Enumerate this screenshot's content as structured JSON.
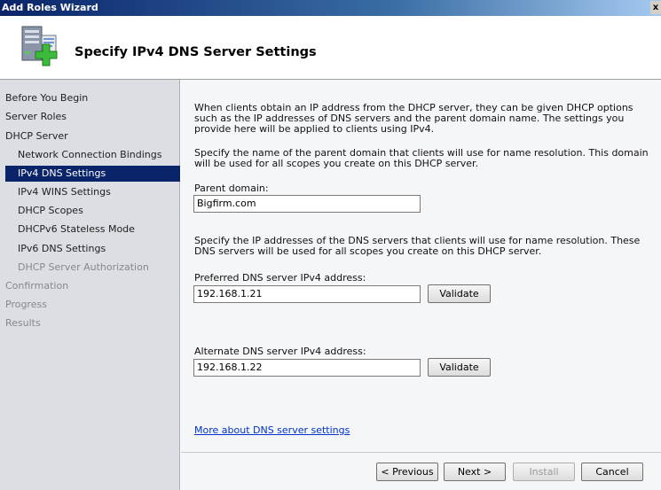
{
  "window": {
    "title": "Add Roles Wizard",
    "close_glyph": "x"
  },
  "header": {
    "title": "Specify IPv4 DNS Server Settings",
    "icon": "server-role-add-icon"
  },
  "sidebar": {
    "items": [
      {
        "label": "Before You Begin",
        "state": "normal"
      },
      {
        "label": "Server Roles",
        "state": "normal"
      },
      {
        "label": "DHCP Server",
        "state": "normal"
      },
      {
        "label": "Network Connection Bindings",
        "state": "normal"
      },
      {
        "label": "IPv4 DNS Settings",
        "state": "active"
      },
      {
        "label": "IPv4 WINS Settings",
        "state": "normal"
      },
      {
        "label": "DHCP Scopes",
        "state": "normal"
      },
      {
        "label": "DHCPv6 Stateless Mode",
        "state": "normal"
      },
      {
        "label": "IPv6 DNS Settings",
        "state": "normal"
      },
      {
        "label": "DHCP Server Authorization",
        "state": "disabled"
      },
      {
        "label": "Confirmation",
        "state": "disabled"
      },
      {
        "label": "Progress",
        "state": "disabled"
      },
      {
        "label": "Results",
        "state": "disabled"
      }
    ]
  },
  "main": {
    "intro": "When clients obtain an IP address from the DHCP server, they can be given DHCP options such as the IP addresses of DNS servers and the parent domain name. The settings you provide here will be applied to clients using IPv4.",
    "domain_text": "Specify the name of the parent domain that clients will use for name resolution. This domain will be used for all scopes you create on this DHCP server.",
    "parent_domain_label": "Parent domain:",
    "parent_domain_value": "Bigfirm.com",
    "dns_text": "Specify the IP addresses of the DNS servers that clients will use for name resolution. These DNS servers will be used for all scopes you create on this DHCP server.",
    "preferred_label": "Preferred DNS server IPv4 address:",
    "preferred_value": "192.168.1.21",
    "alternate_label": "Alternate DNS server IPv4 address:",
    "alternate_value": "192.168.1.22",
    "validate_label": "Validate",
    "more_link": "More about DNS server settings"
  },
  "footer": {
    "previous": "< Previous",
    "next": "Next >",
    "install": "Install",
    "cancel": "Cancel"
  }
}
